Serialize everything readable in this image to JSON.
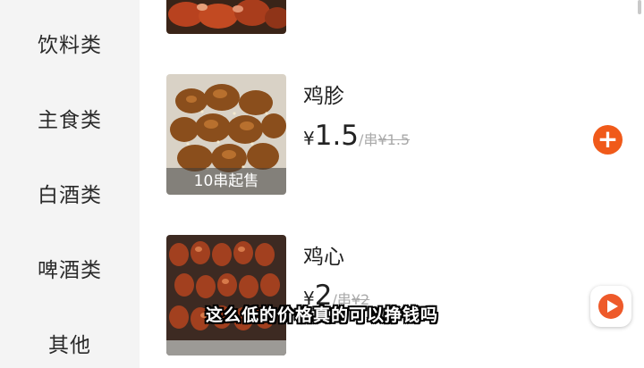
{
  "sidebar": {
    "categories": [
      {
        "label": "饮料类"
      },
      {
        "label": "主食类"
      },
      {
        "label": "白酒类"
      },
      {
        "label": "啤酒类"
      },
      {
        "label": "其他"
      }
    ]
  },
  "products": [
    {
      "name": "鸡胗",
      "currency": "¥",
      "price": "1.5",
      "unit": "/串",
      "original_price": "¥1.5",
      "min_order_badge": "10串起售",
      "image_icon": "grilled-skewer-image"
    },
    {
      "name": "鸡心",
      "currency": "¥",
      "price": "2",
      "unit": "/串",
      "original_price": "¥2",
      "image_icon": "grilled-skewer-image"
    }
  ],
  "add_button_symbol": "+",
  "subtitle": "这么低的价格真的可以挣钱吗",
  "colors": {
    "accent": "#f05a1a",
    "sidebar_bg": "#f4f4f4",
    "muted_text": "#aaaaaa"
  }
}
